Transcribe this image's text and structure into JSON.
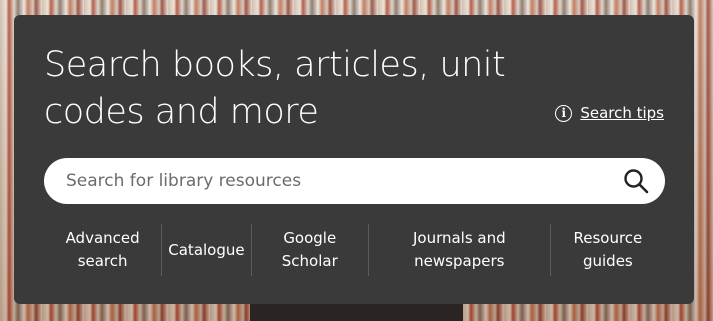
{
  "hero": {
    "headline": "Search books, articles, unit codes and more",
    "search_tips_label": "Search tips",
    "search_placeholder": "Search for library resources"
  },
  "quick_links": [
    {
      "label": "Advanced\nsearch"
    },
    {
      "label": "Catalogue"
    },
    {
      "label": "Google\nScholar"
    },
    {
      "label": "Journals and\nnewspapers"
    },
    {
      "label": "Resource\nguides"
    }
  ],
  "colors": {
    "panel_bg": "#3a3a3a",
    "text": "#ffffff",
    "search_bg": "#ffffff"
  },
  "icons": {
    "info": "info-icon",
    "search": "search-icon"
  }
}
